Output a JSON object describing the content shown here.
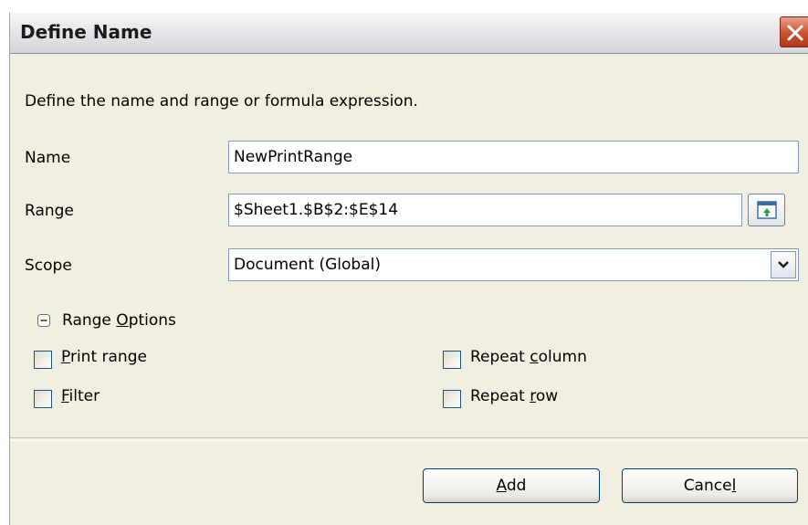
{
  "dialog": {
    "title": "Define Name",
    "instruction": "Define the name and range or formula expression."
  },
  "fields": {
    "name": {
      "label": "Name",
      "value": "NewPrintRange"
    },
    "range": {
      "label": "Range",
      "value": "$Sheet1.$B$2:$E$14"
    },
    "scope": {
      "label": "Scope",
      "value": "Document (Global)"
    }
  },
  "range_options": {
    "label_pre": "Range ",
    "label_mnemonic": "O",
    "label_post": "ptions",
    "expanded": true,
    "print_range": {
      "mnemonic": "P",
      "rest": "rint range",
      "checked": false
    },
    "filter": {
      "mnemonic": "F",
      "rest": "ilter",
      "checked": false
    },
    "repeat_column": {
      "pre": "Repeat ",
      "mnemonic": "c",
      "rest": "olumn",
      "checked": false
    },
    "repeat_row": {
      "pre": "Repeat ",
      "mnemonic": "r",
      "rest": "ow",
      "checked": false
    }
  },
  "buttons": {
    "add": {
      "mnemonic": "A",
      "rest": "dd"
    },
    "cancel": {
      "pre": "Cance",
      "mnemonic": "l"
    }
  },
  "icons": {
    "close": "close-icon",
    "shrink": "shrink-dialog-icon",
    "dropdown": "chevron-down-icon",
    "expander": "collapse-minus-icon"
  },
  "colors": {
    "dialog_bg": "#f1efe2",
    "close_button": "#c8512f",
    "field_border": "#7f9db9",
    "checkbox_border": "#1c5180",
    "button_border": "#003c74"
  }
}
